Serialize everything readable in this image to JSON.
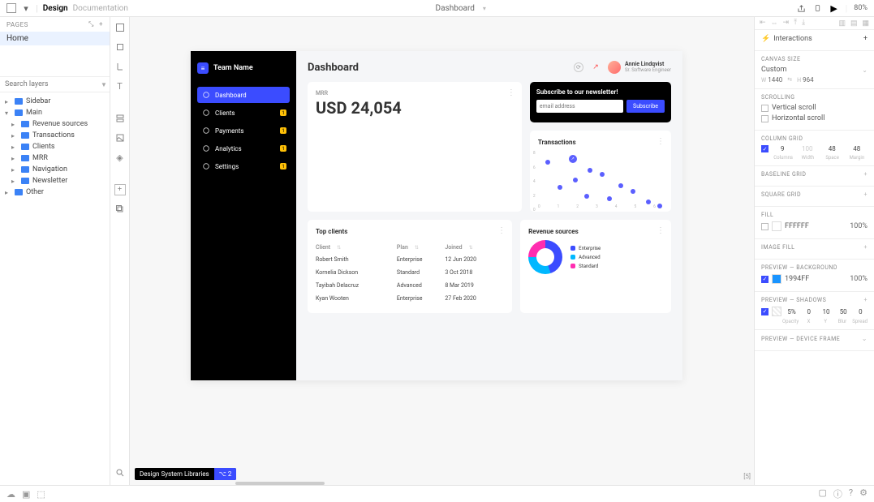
{
  "topbar": {
    "project": "Design",
    "subtitle": "Documentation",
    "page": "Dashboard",
    "zoom": "80%"
  },
  "pages": {
    "header": "Pages",
    "items": [
      "Home"
    ]
  },
  "search": {
    "placeholder": "Search layers"
  },
  "layers": [
    {
      "level": 1,
      "caret": "▸",
      "label": "Sidebar"
    },
    {
      "level": 1,
      "caret": "▾",
      "label": "Main"
    },
    {
      "level": 2,
      "caret": "▸",
      "label": "Revenue sources"
    },
    {
      "level": 2,
      "caret": "▸",
      "label": "Transactions"
    },
    {
      "level": 2,
      "caret": "▸",
      "label": "Clients"
    },
    {
      "level": 2,
      "caret": "▸",
      "label": "MRR"
    },
    {
      "level": 2,
      "caret": "▸",
      "label": "Navigation"
    },
    {
      "level": 2,
      "caret": "▸",
      "label": "Newsletter"
    },
    {
      "level": 1,
      "caret": "▸",
      "label": "Other"
    }
  ],
  "artboard": {
    "team": "Team Name",
    "nav": [
      {
        "label": "Dashboard",
        "active": true
      },
      {
        "label": "Clients",
        "badge": "1"
      },
      {
        "label": "Payments",
        "badge": "1"
      },
      {
        "label": "Analytics",
        "badge": "1"
      },
      {
        "label": "Settings",
        "badge": "1"
      }
    ],
    "title": "Dashboard",
    "user": {
      "name": "Annie Lindqvist",
      "role": "Sr. Software Engineer"
    },
    "mrr": {
      "label": "MRR",
      "value": "USD 24,054"
    },
    "newsletter": {
      "title": "Subscribe to our newsletter!",
      "placeholder": "email address",
      "button": "Subscribe"
    },
    "transactions": {
      "title": "Transactions"
    },
    "top_clients": {
      "title": "Top clients",
      "cols": [
        "Client",
        "Plan",
        "Joined"
      ],
      "rows": [
        [
          "Robert Smith",
          "Enterprise",
          "12 Jun 2020"
        ],
        [
          "Kornelia Dickson",
          "Standard",
          "3 Oct 2018"
        ],
        [
          "Tayibah Delacruz",
          "Advanced",
          "8 Mar 2019"
        ],
        [
          "Kyan Wooten",
          "Enterprise",
          "27 Feb 2020"
        ]
      ]
    },
    "revenue": {
      "title": "Revenue sources",
      "legend": [
        {
          "label": "Enterprise",
          "color": "#3b4cff"
        },
        {
          "label": "Advanced",
          "color": "#00b8ff"
        },
        {
          "label": "Standard",
          "color": "#ff2db0"
        }
      ]
    }
  },
  "chart_data": {
    "type": "scatter",
    "title": "Transactions",
    "x_ticks": [
      0,
      1,
      2,
      3,
      4,
      5,
      6
    ],
    "y_ticks": [
      0,
      2,
      4,
      6,
      8
    ],
    "points": [
      {
        "x": 0.4,
        "y": 6.8
      },
      {
        "x": 1.0,
        "y": 3.2
      },
      {
        "x": 1.6,
        "y": 7.4,
        "label": "↗"
      },
      {
        "x": 1.8,
        "y": 4.2
      },
      {
        "x": 2.4,
        "y": 2.0
      },
      {
        "x": 2.6,
        "y": 5.6
      },
      {
        "x": 3.2,
        "y": 5.0
      },
      {
        "x": 3.6,
        "y": 1.6
      },
      {
        "x": 4.2,
        "y": 3.4
      },
      {
        "x": 4.8,
        "y": 2.6
      },
      {
        "x": 5.6,
        "y": 1.2
      },
      {
        "x": 6.2,
        "y": 0.6
      }
    ]
  },
  "dslib": {
    "label": "Design System Libraries",
    "count": "⌥ 2"
  },
  "layer_count": "[5]",
  "inspector": {
    "interactions": "Interactions",
    "canvas_size": {
      "header": "Canvas Size",
      "mode": "Custom",
      "w_label": "W",
      "w": "1440",
      "h_label": "H",
      "h": "964"
    },
    "scrolling": {
      "header": "Scrolling",
      "v": "Vertical scroll",
      "h": "Horizontal scroll"
    },
    "column_grid": {
      "header": "Column Grid",
      "vals": [
        "9",
        "100",
        "48",
        "48"
      ],
      "labels": [
        "Columns",
        "Width",
        "Space",
        "Margin"
      ]
    },
    "baseline": "Baseline Grid",
    "square": "Square Grid",
    "fill": {
      "header": "Fill",
      "hex": "FFFFFF",
      "opacity": "100%"
    },
    "image_fill": "Image Fill",
    "preview_bg": {
      "header": "Preview — Background",
      "hex": "1994FF",
      "opacity": "100%"
    },
    "preview_shadow": {
      "header": "Preview — Shadows",
      "vals": [
        "5%",
        "0",
        "10",
        "50",
        "0"
      ],
      "labels": [
        "Opacity",
        "X",
        "Y",
        "Blur",
        "Spread"
      ]
    },
    "preview_frame": "Preview — Device Frame"
  }
}
